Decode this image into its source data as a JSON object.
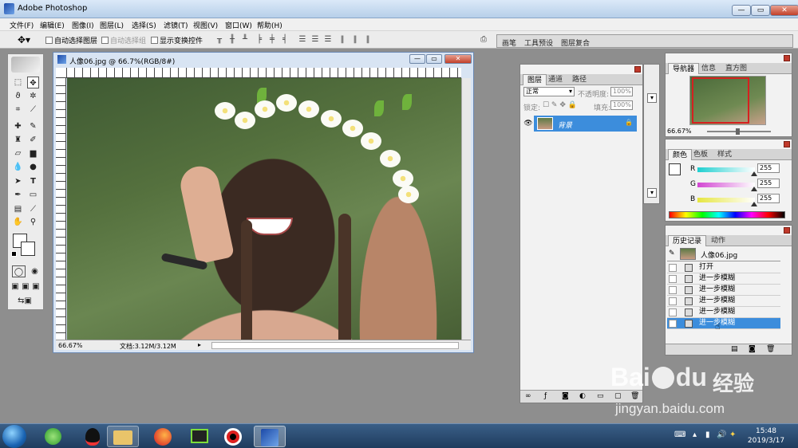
{
  "app": {
    "title": "Adobe Photoshop"
  },
  "window_controls": {
    "minimize": "—",
    "restore": "▭",
    "close": "✕"
  },
  "menubar": [
    "文件(F)",
    "编辑(E)",
    "图像(I)",
    "图层(L)",
    "选择(S)",
    "滤镜(T)",
    "视图(V)",
    "窗口(W)",
    "帮助(H)"
  ],
  "options_bar": {
    "auto_select_layer": "自动选择图层",
    "auto_select_group": "自动选择组",
    "show_transform": "显示变换控件"
  },
  "palette_well": {
    "tabs": [
      "画笔",
      "工具预设",
      "图层复合"
    ]
  },
  "document": {
    "title": "人像06.jpg @ 66.7%(RGB/8#)",
    "zoom": "66.67%",
    "doc_info": "文档:3.12M/3.12M"
  },
  "layers_panel": {
    "tabs": [
      "图层",
      "通道",
      "路径"
    ],
    "blend_mode": "正常",
    "opacity_label": "不透明度:",
    "opacity_value": "100%",
    "lock_label": "锁定:",
    "fill_label": "填充:",
    "fill_value": "100%",
    "layer_name": "背景"
  },
  "navigator_panel": {
    "tabs": [
      "导航器",
      "信息",
      "直方图"
    ],
    "zoom": "66.67%"
  },
  "color_panel": {
    "tabs": [
      "颜色",
      "色板",
      "样式"
    ],
    "channels": [
      {
        "label": "R",
        "value": "255"
      },
      {
        "label": "G",
        "value": "255"
      },
      {
        "label": "B",
        "value": "255"
      }
    ]
  },
  "history_panel": {
    "tabs": [
      "历史记录",
      "动作"
    ],
    "snapshot": "人像06.jpg",
    "items": [
      "打开",
      "进一步模糊",
      "进一步模糊",
      "进一步模糊",
      "进一步模糊",
      "进一步模糊"
    ],
    "active_index": 5
  },
  "taskbar": {
    "time": "15:48",
    "date": "2019/3/17"
  },
  "watermark": {
    "brand_a": "Bai",
    "brand_b": "du",
    "brand_cn": "经验",
    "url": "jingyan.baidu.com"
  },
  "colors": {
    "accent": "#3c8ddc",
    "r_slider": "#1ecfd0",
    "g_slider": "#d246d2",
    "b_slider": "#e6e640"
  }
}
